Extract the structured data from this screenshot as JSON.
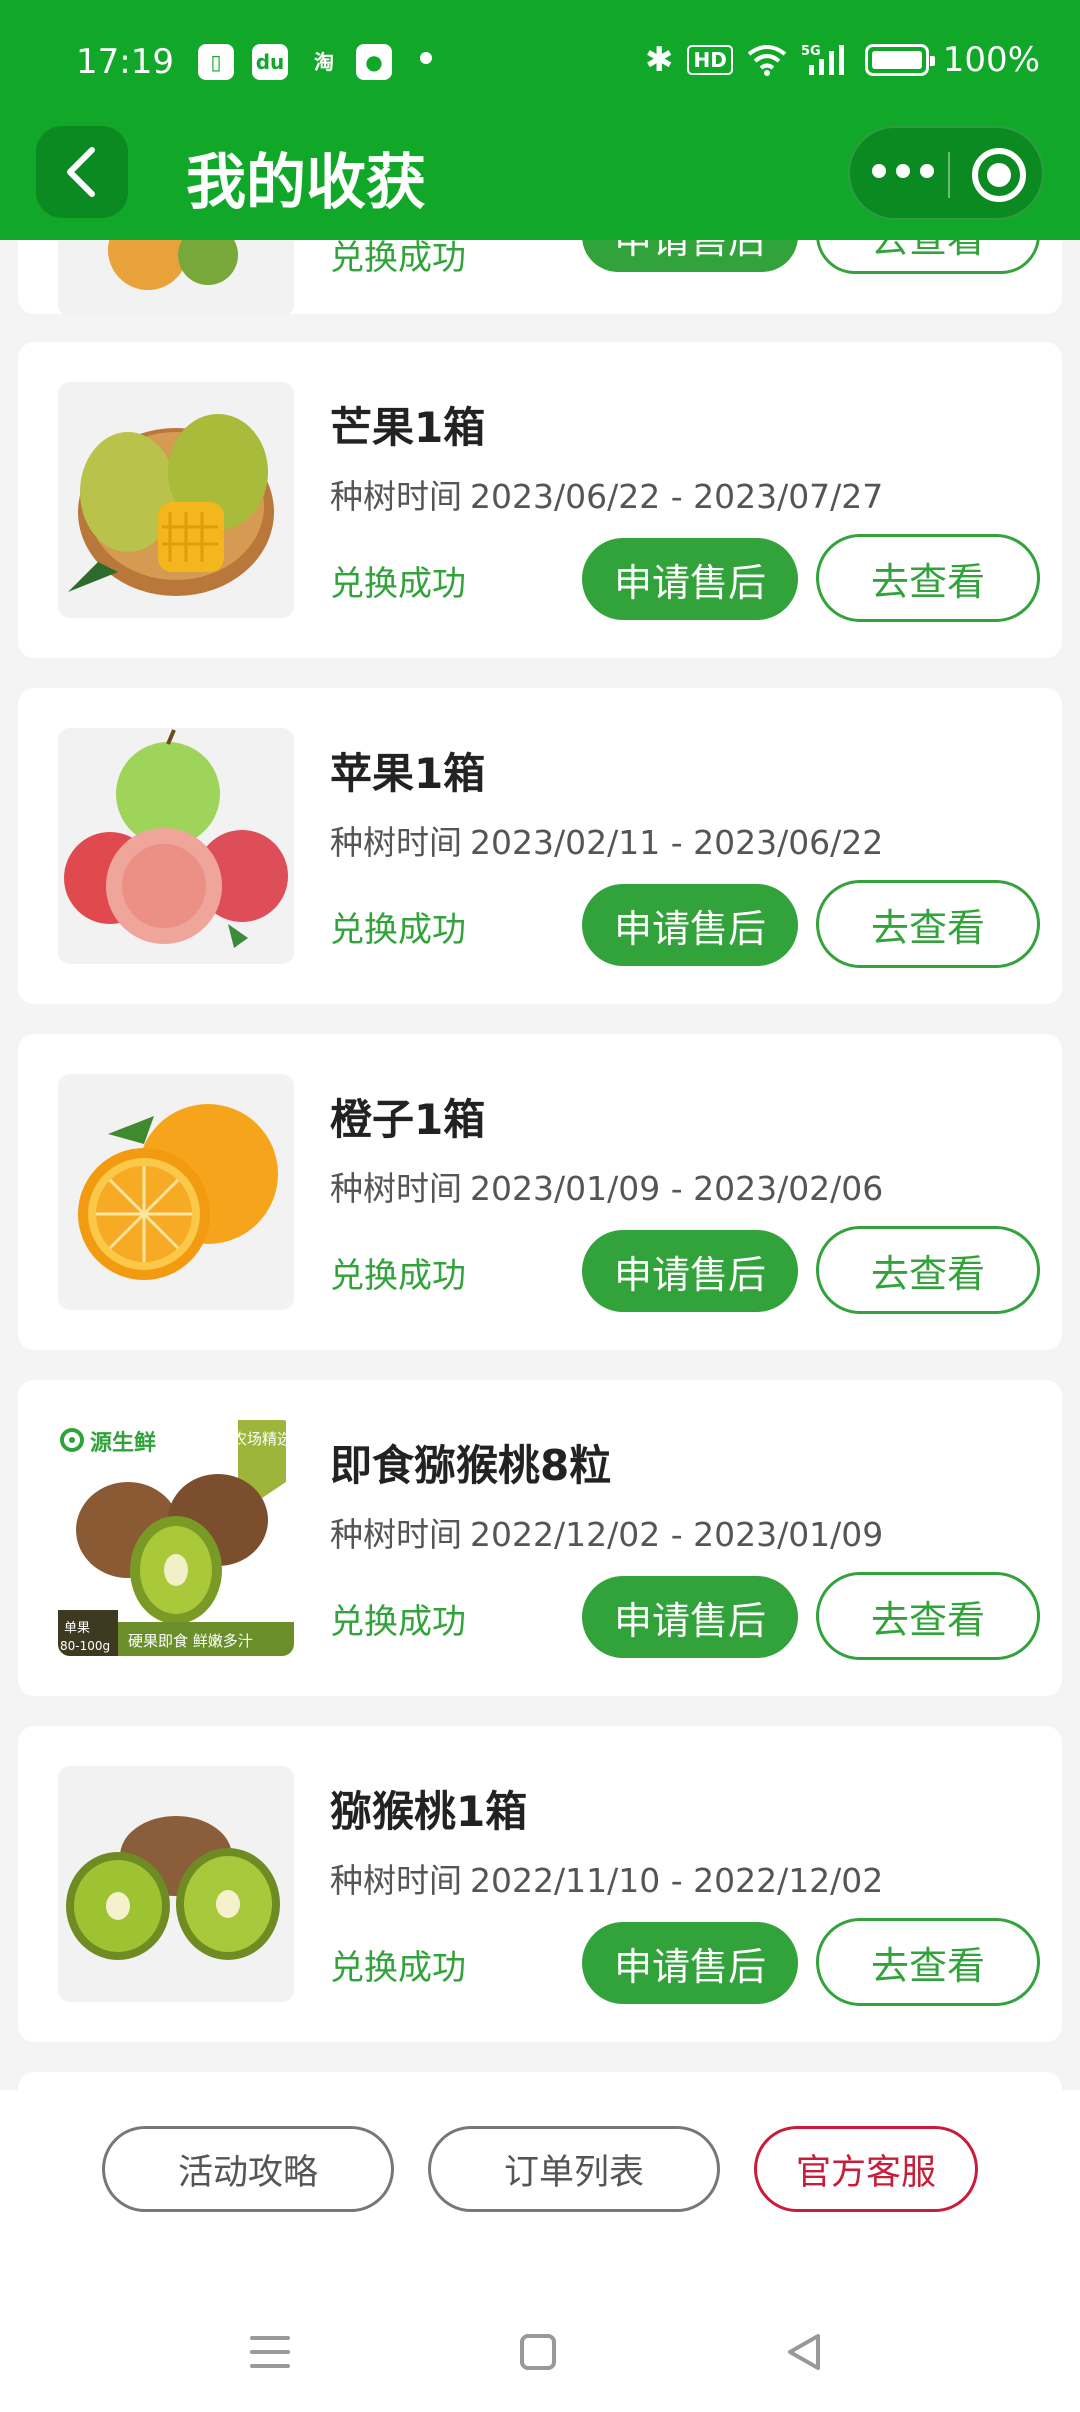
{
  "status_bar": {
    "time": "17:19",
    "app_icons": [
      "sim-icon",
      "baidu-icon",
      "taobao-icon",
      "media-icon"
    ],
    "indicators": [
      "bluetooth-icon",
      "hd-icon",
      "wifi-icon",
      "5g-signal-icon"
    ],
    "battery": "100%"
  },
  "header": {
    "title": "我的收获",
    "back_icon": "chevron-left-icon",
    "menu_icon": "more-dots-icon",
    "close_icon": "target-icon"
  },
  "colors": {
    "brand_green": "#11a82a",
    "button_green": "#32a33a",
    "service_red": "#c81d3a"
  },
  "partial_card": {
    "status": "兑换成功",
    "after_sale": "申请售后",
    "view": "去查看"
  },
  "harvests": [
    {
      "title": "芒果1箱",
      "period_label": "种树时间",
      "period": "2023/06/22 - 2023/07/27",
      "status": "兑换成功",
      "after_sale": "申请售后",
      "view": "去查看",
      "image": "mango"
    },
    {
      "title": "苹果1箱",
      "period_label": "种树时间",
      "period": "2023/02/11 - 2023/06/22",
      "status": "兑换成功",
      "after_sale": "申请售后",
      "view": "去查看",
      "image": "apple"
    },
    {
      "title": "橙子1箱",
      "period_label": "种树时间",
      "period": "2023/01/09 - 2023/02/06",
      "status": "兑换成功",
      "after_sale": "申请售后",
      "view": "去查看",
      "image": "orange"
    },
    {
      "title": "即食猕猴桃8粒",
      "period_label": "种树时间",
      "period": "2022/12/02 - 2023/01/09",
      "status": "兑换成功",
      "after_sale": "申请售后",
      "view": "去查看",
      "image": "kiwi-pack",
      "image_text": {
        "brand": "源生鲜",
        "tag": "农场精选",
        "unit": "单果",
        "weight": "80-100g",
        "slogan": "硬果即食 鲜嫩多汁"
      }
    },
    {
      "title": "猕猴桃1箱",
      "period_label": "种树时间",
      "period": "2022/11/10 - 2022/12/02",
      "status": "兑换成功",
      "after_sale": "申请售后",
      "view": "去查看",
      "image": "kiwi"
    }
  ],
  "bottom_actions": {
    "guide": "活动攻略",
    "orders": "订单列表",
    "service": "官方客服"
  },
  "nav_bar": [
    "menu-icon",
    "home-square-icon",
    "back-triangle-icon"
  ]
}
